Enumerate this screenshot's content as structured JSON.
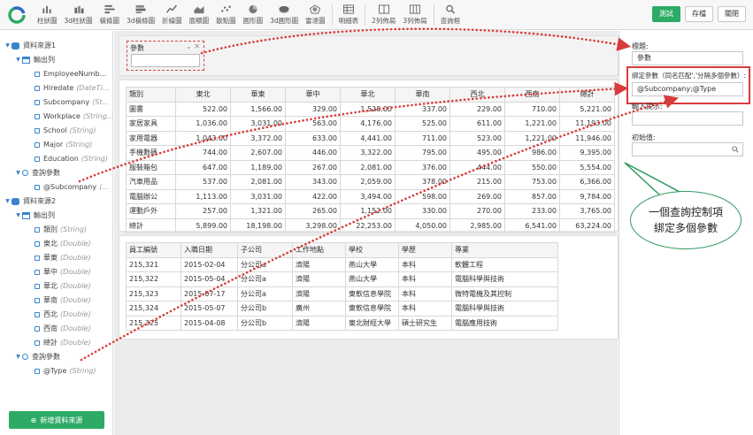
{
  "toolbar": {
    "tools": [
      {
        "label": "柱狀圖",
        "icon": "bar-chart-icon"
      },
      {
        "label": "3d柱狀圖",
        "icon": "3d-bar-chart-icon"
      },
      {
        "label": "橫條圖",
        "icon": "horizontal-bar-icon"
      },
      {
        "label": "3d橫條圖",
        "icon": "3d-horizontal-bar-icon"
      },
      {
        "label": "折線圖",
        "icon": "line-chart-icon"
      },
      {
        "label": "面積圖",
        "icon": "area-chart-icon"
      },
      {
        "label": "散點圖",
        "icon": "scatter-chart-icon"
      },
      {
        "label": "圓形圖",
        "icon": "pie-chart-icon"
      },
      {
        "label": "3d圓形圖",
        "icon": "3d-pie-chart-icon"
      },
      {
        "label": "雷達圖",
        "icon": "radar-chart-icon"
      },
      {
        "label": "明細表",
        "icon": "detail-table-icon"
      },
      {
        "label": "2列佈局",
        "icon": "two-column-layout-icon"
      },
      {
        "label": "3列佈局",
        "icon": "three-column-layout-icon"
      },
      {
        "label": "查詢框",
        "icon": "query-box-icon"
      }
    ],
    "test_label": "測試",
    "save_label": "存檔",
    "close_label": "關閉"
  },
  "left_panel": {
    "sources": [
      {
        "name": "資料來源1",
        "output_label": "輸出列",
        "fields": [
          {
            "name": "EmployeeNumb...",
            "type": ""
          },
          {
            "name": "Hiredate",
            "type": "(DateTi..."
          },
          {
            "name": "Subcompany",
            "type": "(St..."
          },
          {
            "name": "Workplace",
            "type": "(String..."
          },
          {
            "name": "School",
            "type": "(String)"
          },
          {
            "name": "Major",
            "type": "(String)"
          },
          {
            "name": "Education",
            "type": "(String)"
          }
        ],
        "query_label": "查詢參數",
        "params": [
          {
            "name": "@Subcompany",
            "type": "(..."
          }
        ]
      },
      {
        "name": "資料來源2",
        "output_label": "輸出列",
        "fields": [
          {
            "name": "類別",
            "type": "(String)"
          },
          {
            "name": "東北",
            "type": "(Double)"
          },
          {
            "name": "華東",
            "type": "(Double)"
          },
          {
            "name": "華中",
            "type": "(Double)"
          },
          {
            "name": "華北",
            "type": "(Double)"
          },
          {
            "name": "華南",
            "type": "(Double)"
          },
          {
            "name": "西北",
            "type": "(Double)"
          },
          {
            "name": "西南",
            "type": "(Double)"
          },
          {
            "name": "總計",
            "type": "(Double)"
          }
        ],
        "query_label": "查詢參數",
        "params": [
          {
            "name": "@Type",
            "type": "(String)"
          }
        ]
      }
    ],
    "add_source_label": "新增資料來源"
  },
  "param_control": {
    "header": "參數"
  },
  "table1": {
    "headers": [
      "類別",
      "東北",
      "華東",
      "華中",
      "華北",
      "華南",
      "西北",
      "西南",
      "總計"
    ],
    "rows": [
      [
        "圖書",
        "522.00",
        "1,566.00",
        "329.00",
        "1,528.00",
        "337.00",
        "229.00",
        "710.00",
        "5,221.00"
      ],
      [
        "家居家具",
        "1,036.00",
        "3,031.00",
        "563.00",
        "4,176.00",
        "525.00",
        "611.00",
        "1,221.00",
        "11,193.00"
      ],
      [
        "家用電器",
        "1,043.00",
        "3,372.00",
        "633.00",
        "4,441.00",
        "711.00",
        "523.00",
        "1,221.00",
        "11,946.00"
      ],
      [
        "手機數碼",
        "744.00",
        "2,607.00",
        "446.00",
        "3,322.00",
        "795.00",
        "495.00",
        "986.00",
        "9,395.00"
      ],
      [
        "服裝箱包",
        "647.00",
        "1,189.00",
        "267.00",
        "2,081.00",
        "376.00",
        "444.00",
        "550.00",
        "5,554.00"
      ],
      [
        "汽車用品",
        "537.00",
        "2,081.00",
        "343.00",
        "2,059.00",
        "378.00",
        "215.00",
        "753.00",
        "6,366.00"
      ],
      [
        "電腦辦公",
        "1,113.00",
        "3,031.00",
        "422.00",
        "3,494.00",
        "598.00",
        "269.00",
        "857.00",
        "9,784.00"
      ],
      [
        "運動戶外",
        "257.00",
        "1,321.00",
        "265.00",
        "1,152.00",
        "330.00",
        "270.00",
        "233.00",
        "3,765.00"
      ],
      [
        "總計",
        "5,899.00",
        "18,198.00",
        "3,298.00",
        "22,253.00",
        "4,050.00",
        "2,985.00",
        "6,541.00",
        "63,224.00"
      ]
    ]
  },
  "table2": {
    "headers": [
      "員工編號",
      "入職日期",
      "子公司",
      "工作地點",
      "學校",
      "學歷",
      "專業"
    ],
    "rows": [
      [
        "215,321",
        "2015-02-04",
        "分公司a",
        "濟陽",
        "燕山大學",
        "本科",
        "軟體工程"
      ],
      [
        "215,322",
        "2015-05-04",
        "分公司a",
        "濟陽",
        "燕山大學",
        "本科",
        "電腦科學與技術"
      ],
      [
        "215,323",
        "2015-07-17",
        "分公司a",
        "濟陽",
        "東軟信息學院",
        "本科",
        "微特電機及其控制"
      ],
      [
        "215,324",
        "2015-05-07",
        "分公司b",
        "廣州",
        "東軟信息學院",
        "本科",
        "電腦科學與技術"
      ],
      [
        "215,325",
        "2015-04-08",
        "分公司b",
        "濟陽",
        "東北財經大學",
        "碩士研究生",
        "電腦應用技術"
      ]
    ]
  },
  "right_panel": {
    "title_label": "標題:",
    "title_value": "參數",
    "bind_label": "綁定參數（同名匹配','分隔多個參數）:",
    "bind_value": "@Subcompany;@Type",
    "hint_label": "輸入提示:",
    "hint_value": "",
    "initial_label": "初始值:",
    "initial_value": ""
  },
  "callout": {
    "line1": "一個查詢控制項",
    "line2": "綁定多個參數"
  },
  "colors": {
    "accent_green": "#2dab66",
    "annotation_red": "#d73b3b",
    "tree_blue": "#3a85d0"
  }
}
